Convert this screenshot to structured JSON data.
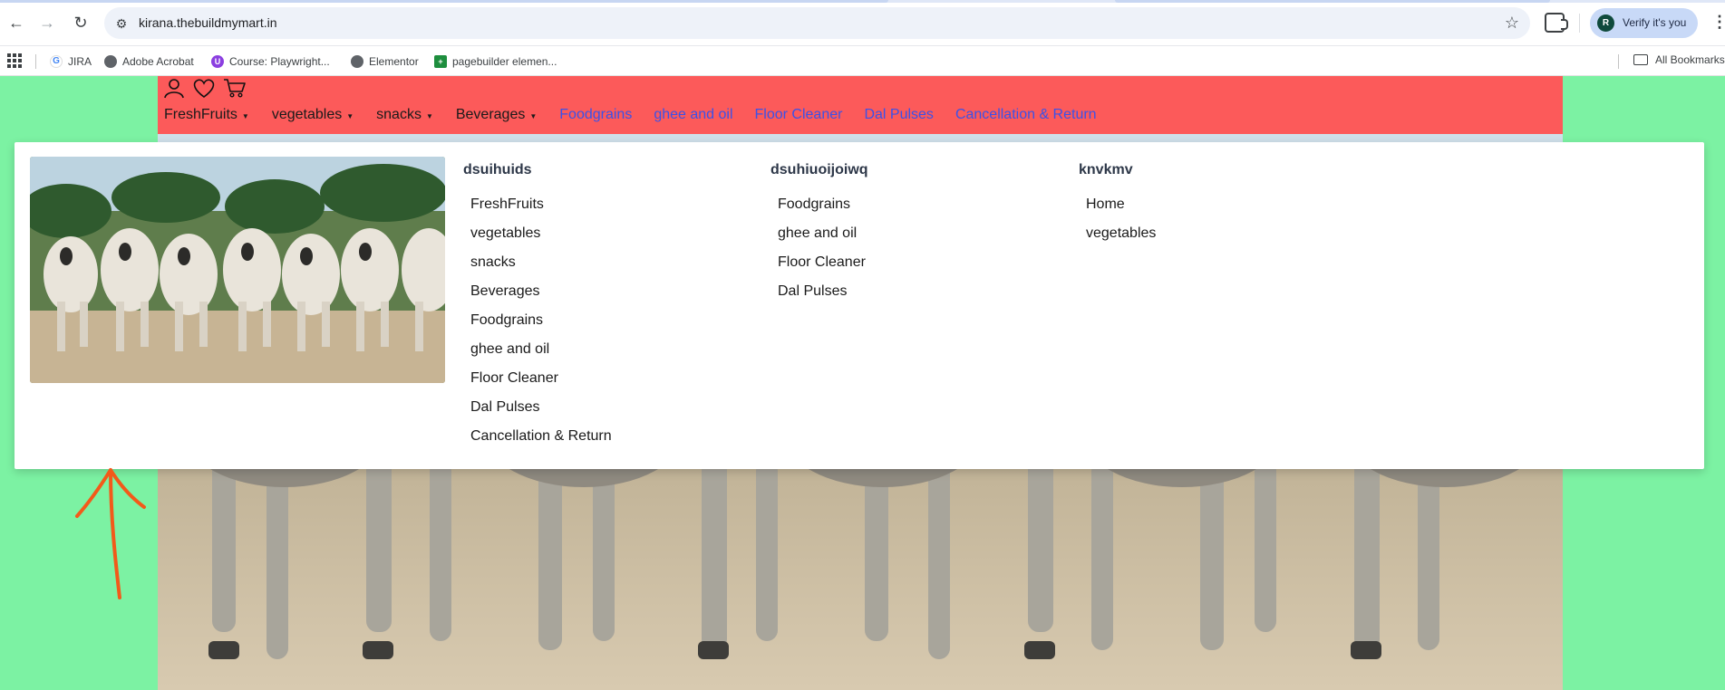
{
  "browser": {
    "url": "kirana.thebuildmymart.in",
    "profile_initial": "R",
    "profile_label": "Verify it's you",
    "bookmarks": [
      {
        "label": "JIRA",
        "icon": "google-icon"
      },
      {
        "label": "Adobe Acrobat",
        "icon": "globe-icon"
      },
      {
        "label": "Course: Playwright...",
        "icon": "course-icon"
      },
      {
        "label": "Elementor",
        "icon": "globe-icon"
      },
      {
        "label": "pagebuilder elemen...",
        "icon": "sheets-icon"
      }
    ],
    "all_bookmarks": "All Bookmarks"
  },
  "site": {
    "nav": {
      "dropdowns": [
        "FreshFruits",
        "vegetables",
        "snacks",
        "Beverages"
      ],
      "links": [
        "Foodgrains",
        "ghee and oil",
        "Floor Cleaner",
        "Dal Pulses",
        "Cancellation & Return"
      ]
    },
    "mega_menu": {
      "columns": [
        {
          "title": "dsuihuids",
          "items": [
            "FreshFruits",
            "vegetables",
            "snacks",
            "Beverages",
            "Foodgrains",
            "ghee and oil",
            "Floor Cleaner",
            "Dal Pulses",
            "Cancellation & Return"
          ]
        },
        {
          "title": "dsuhiuoijoiwq",
          "items": [
            "Foodgrains",
            "ghee and oil",
            "Floor Cleaner",
            "Dal Pulses"
          ]
        },
        {
          "title": "knvkmv",
          "items": [
            "Home",
            "vegetables"
          ]
        }
      ]
    }
  },
  "colors": {
    "page_bg": "#7cf2a3",
    "header_bg": "#fc5a5a",
    "nav_link": "#3b52e8",
    "annotation_arrow": "#f25a1a"
  }
}
